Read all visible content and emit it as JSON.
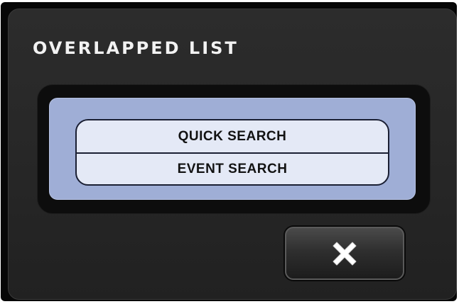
{
  "dialog": {
    "title": "OVERLAPPED LIST"
  },
  "list": {
    "items": [
      {
        "label": "QUICK SEARCH"
      },
      {
        "label": "EVENT SEARCH"
      }
    ]
  },
  "close_button": {
    "icon": "close-icon"
  },
  "colors": {
    "dialog_background": "#262626",
    "panel_background": "#9faed6",
    "list_item_background": "#e4e9f6",
    "title_text": "#f2f2f2"
  }
}
